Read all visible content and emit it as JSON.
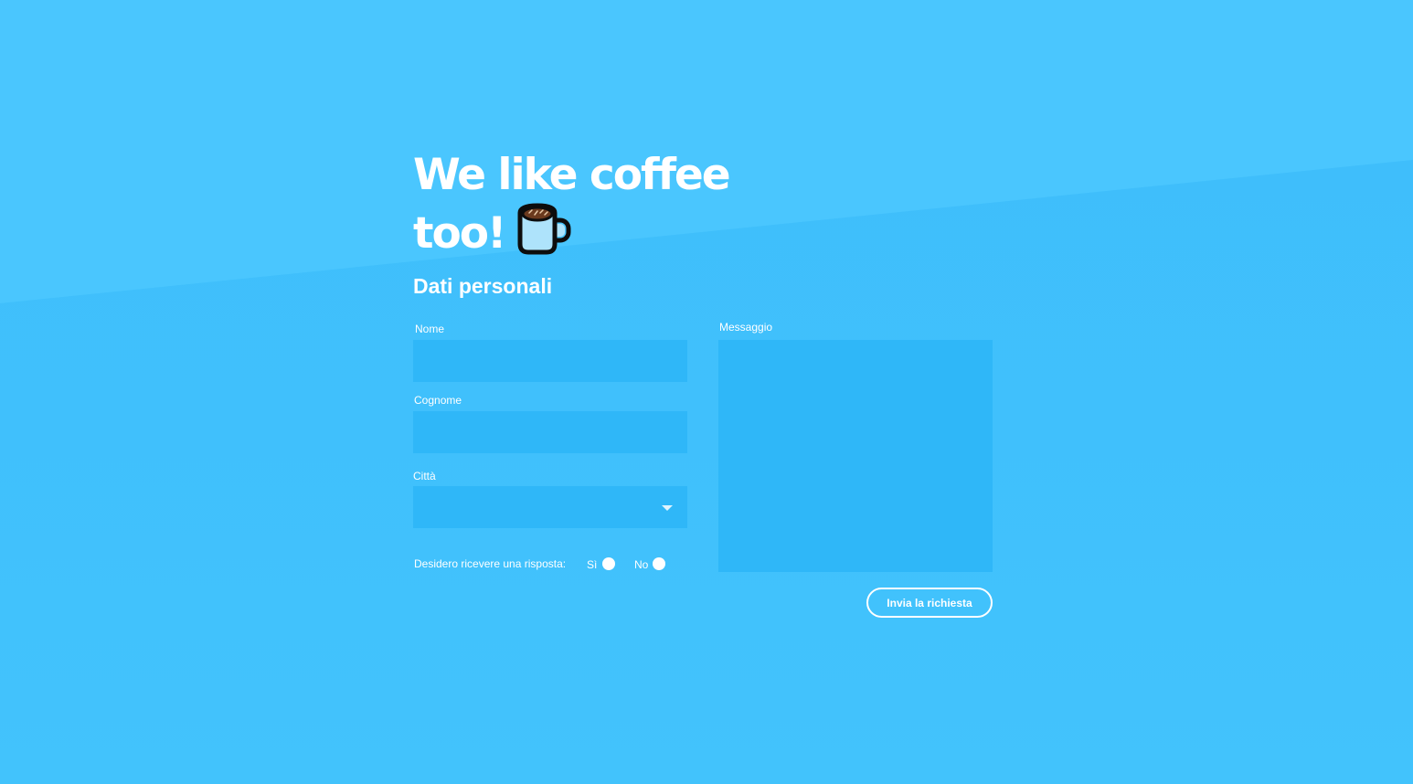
{
  "hero": {
    "line1": "We like coffee",
    "line2": "too!",
    "icon": "coffee-mug-icon"
  },
  "form": {
    "section_title": "Dati personali",
    "nome": {
      "label": "Nome",
      "value": "",
      "placeholder": ""
    },
    "cognome": {
      "label": "Cognome",
      "value": "",
      "placeholder": ""
    },
    "citta": {
      "label": "Città",
      "selected": ""
    },
    "messaggio": {
      "label": "Messaggio",
      "value": "",
      "placeholder": ""
    },
    "risposta": {
      "question": "Desidero ricevere una risposta:",
      "options": [
        "Sì",
        "No"
      ]
    },
    "submit_label": "Invia la richiesta"
  },
  "colors": {
    "background_top": "#4ac6fe",
    "background_bottom": "#3ebdfb",
    "field_fill": "#2fb7f8",
    "text": "#ffffff"
  }
}
